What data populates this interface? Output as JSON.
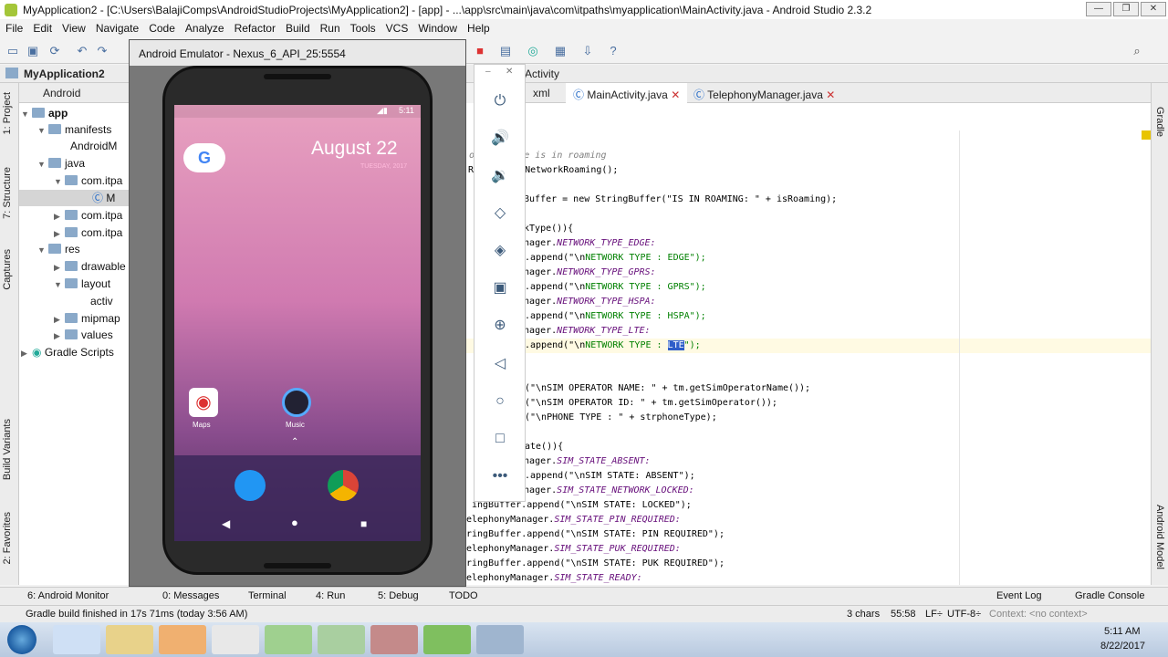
{
  "window": {
    "title": "MyApplication2 - [C:\\Users\\BalajiComps\\AndroidStudioProjects\\MyApplication2] - [app] - ...\\app\\src\\main\\java\\com\\itpaths\\myapplication\\MainActivity.java - Android Studio 2.3.2"
  },
  "menu": [
    "File",
    "Edit",
    "View",
    "Navigate",
    "Code",
    "Analyze",
    "Refactor",
    "Build",
    "Run",
    "Tools",
    "VCS",
    "Window",
    "Help"
  ],
  "breadcrumb": {
    "project": "MyApplication2",
    "activity": "Activity"
  },
  "project_panel": {
    "header": "Android",
    "tree": [
      "app",
      "manifests",
      "AndroidM",
      "java",
      "com.itpa",
      "M",
      "com.itpa",
      "com.itpa",
      "res",
      "drawable",
      "layout",
      "activ",
      "mipmap",
      "values",
      "Gradle Scripts"
    ]
  },
  "side_tabs": {
    "left": [
      "1: Project",
      "7: Structure",
      "Captures",
      "Build Variants",
      "2: Favorites"
    ],
    "right": [
      "Gradle",
      "Android Model"
    ]
  },
  "emulator": {
    "title": "Android Emulator - Nexus_6_API_25:5554",
    "time": "5:11",
    "date": "August 22",
    "day": "TUESDAY, 2017",
    "apps": [
      "Maps",
      "Music"
    ]
  },
  "editor_tabs": [
    {
      "label": "xml"
    },
    {
      "label": "MainActivity.java",
      "active": true
    },
    {
      "label": "TelephonyManager.java"
    }
  ],
  "code": {
    "c1": "on if phone is in roaming",
    "c2": "R",
    "c3": "n.isNetworkRoaming();",
    "c4": "Buffer = new StringBuffer(\"IS IN ROAMING: \" + isRoaming);",
    "c5": "rkType()){",
    "c6": "Manager.",
    "c6b": "NETWORK_TYPE_EDGE:",
    "c7": ".append(\"\\n",
    "c7b": "NETWORK TYPE : EDGE\");",
    "c8": "Manager.",
    "c8b": "NETWORK_TYPE_GPRS:",
    "c9": ".append(\"\\n",
    "c9b": "NETWORK TYPE : GPRS\");",
    "c10": "Manager.",
    "c10b": "NETWORK_TYPE_HSPA:",
    "c11": ".append(\"\\n",
    "c11b": "NETWORK TYPE : HSPA\");",
    "c12": "Manager.",
    "c12b": "NETWORK_TYPE_LTE:",
    "c13": ".append(\"\\n",
    "c13b": "NETWORK TYPE : ",
    "c13c": "LTE",
    "c13d": "\");",
    "c14": "(\"\\nSIM OPERATOR NAME: \" + tm.getSimOperatorName());",
    "c15": "(\"\\nSIM OPERATOR ID: \" + tm.getSimOperator());",
    "c16": "(\"\\nPHONE TYPE : \" + strphoneType);",
    "c17": "ate()){",
    "c18": "Manager.",
    "c18b": "SIM_STATE_ABSENT:",
    "c19": ".append(\"\\nSIM STATE: ABSENT\");",
    "c20": "Manager.",
    "c20b": "SIM_STATE_NETWORK_LOCKED:",
    "c21": "ingBuffer.append(\"\\nSIM STATE: LOCKED\");",
    "c22": "elephonyManager.",
    "c22b": "SIM_STATE_PIN_REQUIRED:",
    "c23": "ringBuffer.append(\"\\nSIM STATE: PIN REQUIRED\");",
    "c24": "elephonyManager.",
    "c24b": "SIM_STATE_PUK_REQUIRED:",
    "c25": "ringBuffer.append(\"\\nSIM STATE: PUK REQUIRED\");",
    "c26": "elephonyManager.",
    "c26b": "SIM_STATE_READY:"
  },
  "tool_windows": {
    "monitor": "6: Android Monitor",
    "messages": "0: Messages",
    "terminal": "Terminal",
    "run": "4: Run",
    "debug": "5: Debug",
    "todo": "TODO",
    "event_log": "Event Log",
    "gradle_console": "Gradle Console"
  },
  "status_bar": {
    "message": "Gradle build finished in 17s 71ms (today 3:56 AM)",
    "chars": "3 chars",
    "position": "55:58",
    "line_sep": "LF÷",
    "encoding": "UTF-8÷",
    "context": "Context: <no context>"
  },
  "taskbar": {
    "time": "5:11 AM",
    "date": "8/22/2017"
  }
}
